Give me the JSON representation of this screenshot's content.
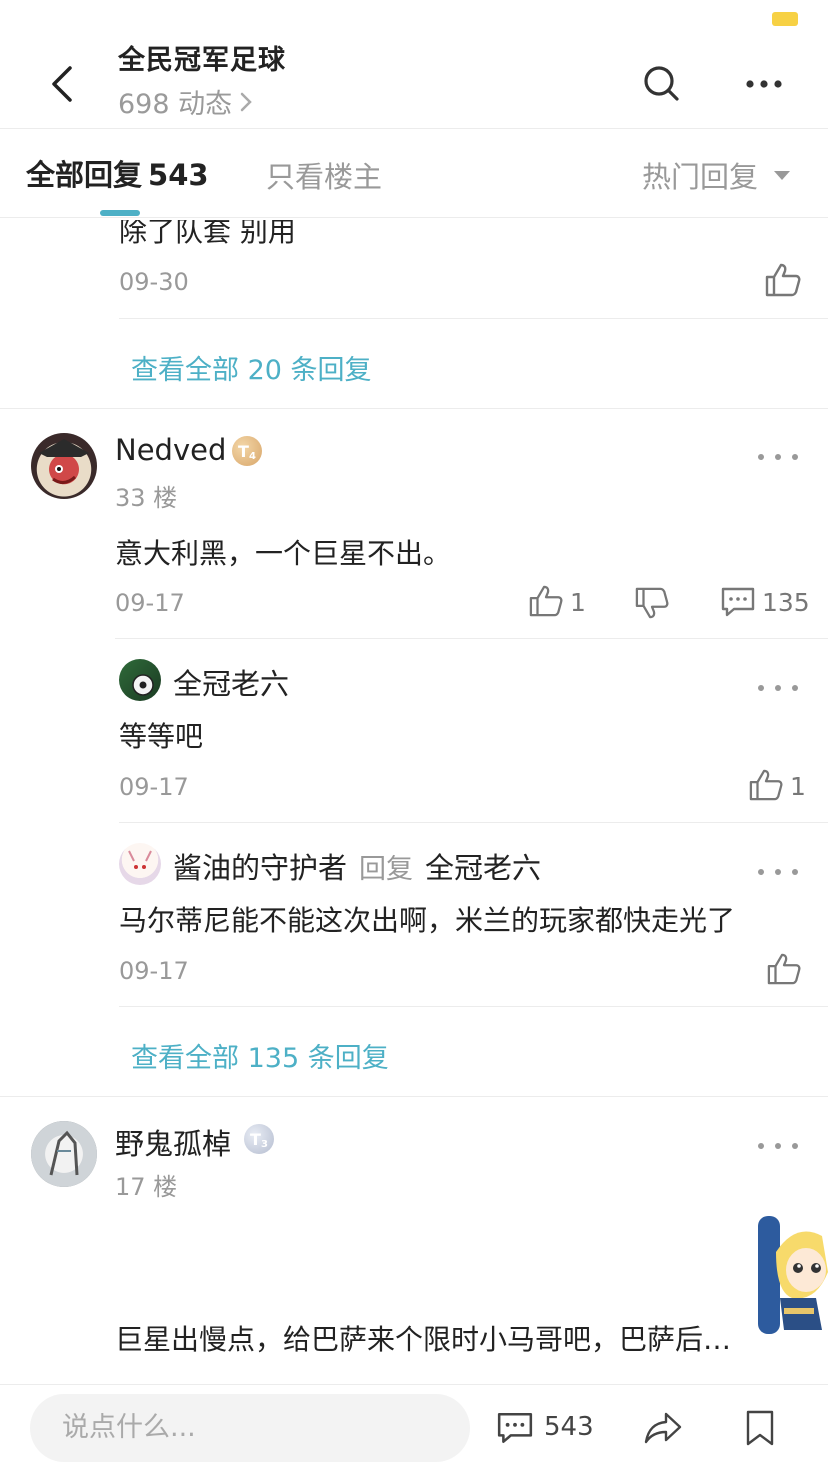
{
  "header": {
    "title": "全民冠军足球",
    "subtitle": "698 动态"
  },
  "tabs": {
    "all_label": "全部回复",
    "all_count": "543",
    "owner_label": "只看楼主",
    "sort_label": "热门回复"
  },
  "thread1": {
    "partial_text": "除了队套 别用",
    "date": "09-30",
    "view_all": "查看全部 20 条回复"
  },
  "post33": {
    "user": "Nedved",
    "badge": "T",
    "badge_sub": "4",
    "floor": "33 楼",
    "content": "意大利黑，一个巨星不出。",
    "date": "09-17",
    "likes": "1",
    "comments": "135",
    "replies": [
      {
        "user": "全冠老六",
        "content": "等等吧",
        "date": "09-17",
        "likes": "1"
      },
      {
        "user": "酱油的守护者",
        "reply_word": "回复",
        "reply_to": "全冠老六",
        "content": "马尔蒂尼能不能这次出啊，米兰的玩家都快走光了",
        "date": "09-17"
      }
    ],
    "view_all": "查看全部 135 条回复"
  },
  "post17": {
    "user": "野鬼孤棹",
    "badge": "T",
    "badge_sub": "3",
    "floor": "17 楼",
    "content": "巨星出慢点，给巴萨来个限时小马哥吧，巴萨后…"
  },
  "bottom": {
    "placeholder": "说点什么...",
    "comment_count": "543"
  },
  "colors": {
    "accent": "#4db0c6",
    "muted": "#999999",
    "battery": "#f7d144"
  }
}
